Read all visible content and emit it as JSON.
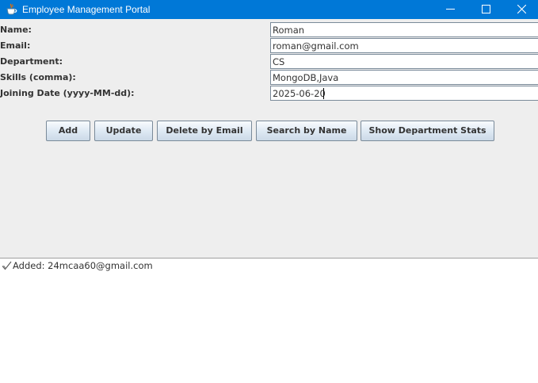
{
  "window": {
    "title": "Employee Management Portal",
    "app_icon": "java-coffee-cup-icon",
    "controls": [
      "minimize-icon",
      "maximize-icon",
      "close-icon"
    ],
    "titlebar_color": "#0078d7"
  },
  "form": {
    "fields": [
      {
        "label": "Name:",
        "value": "Roman"
      },
      {
        "label": "Email:",
        "value": "roman@gmail.com"
      },
      {
        "label": "Department:",
        "value": "CS"
      },
      {
        "label": "Skills (comma):",
        "value": "MongoDB,Java"
      },
      {
        "label": "Joining Date (yyyy-MM-dd):",
        "value": "2025-06-20"
      }
    ]
  },
  "buttons": {
    "add": "Add",
    "update": "Update",
    "delete": "Delete by Email",
    "search": "Search by Name",
    "stats": "Show Department Stats"
  },
  "output": {
    "icon": "check-mark-icon",
    "message": "Added: 24mcaa60@gmail.com"
  }
}
